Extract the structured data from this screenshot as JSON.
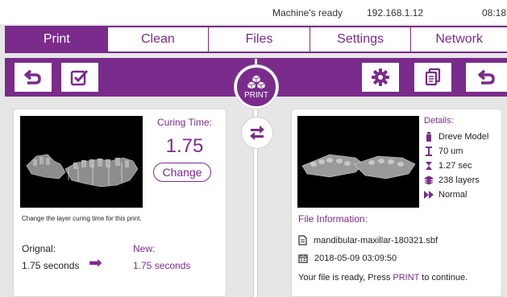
{
  "status": {
    "machine": "Machine's ready",
    "ip": "192.168.1.12",
    "time": "08:18"
  },
  "tabs": [
    {
      "label": "Print",
      "active": true
    },
    {
      "label": "Clean",
      "active": false
    },
    {
      "label": "Files",
      "active": false
    },
    {
      "label": "Settings",
      "active": false
    },
    {
      "label": "Network",
      "active": false
    }
  ],
  "toolbar": {
    "left_icons": [
      "undo-icon",
      "checkbox-icon"
    ],
    "right_icons": [
      "gear-icon",
      "copy-icon",
      "undo-icon"
    ],
    "print_label": "PRINT"
  },
  "curing": {
    "label": "Curing Time:",
    "value": "1.75",
    "change_label": "Change",
    "hint": "Change the layer curing time for this print.",
    "original_label": "Orignal:",
    "original_value": "1.75 seconds",
    "new_label": "New:",
    "new_value": "1.75 seconds"
  },
  "details": {
    "title": "Details:",
    "material": "Dreve Model",
    "layer_thickness": "70 um",
    "exposure": "1.27 sec",
    "layers": "238 layers",
    "mode": "Normal"
  },
  "file_info": {
    "title": "File Information:",
    "filename": "mandibular-maxillar-180321.sbf",
    "date": "2018-05-09 03:09:50",
    "ready_msg_pre": "Your file is ready, Press ",
    "ready_msg_hl": "PRINT",
    "ready_msg_post": " to continue."
  },
  "colors": {
    "accent": "#7a2b8c",
    "background": "#e6e6e6"
  }
}
